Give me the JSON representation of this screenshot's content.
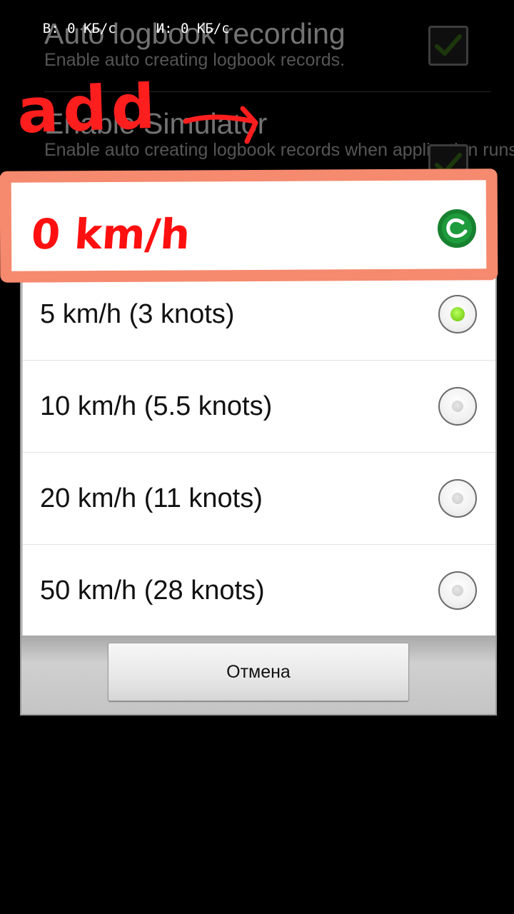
{
  "status_bar": {
    "download": "В: 0 КБ/с",
    "upload": "И: 0 КБ/с"
  },
  "preferences": [
    {
      "title": "Auto logbook recording",
      "summary": "Enable auto creating logbook records.",
      "checked": true
    },
    {
      "title": "Enable Simulator",
      "summary": "Enable auto creating logbook records when application runs in simulator mode",
      "checked": true
    }
  ],
  "dialog": {
    "options": [
      {
        "label": "5 km/h (3 knots)",
        "selected": true
      },
      {
        "label": "10 km/h (5.5 knots)",
        "selected": false
      },
      {
        "label": "20 km/h (11 knots)",
        "selected": false
      },
      {
        "label": "50 km/h (28 knots)",
        "selected": false
      }
    ],
    "cancel_label": "Отмена"
  },
  "annotation": {
    "note": "add",
    "proposed_option": "0 km/h",
    "colors": {
      "ink_red": "#ff1e1e",
      "box_salmon": "#f58a6f",
      "ink_green": "#1e9b3c"
    }
  },
  "colors": {
    "radio_selected": "#7fd321",
    "check_green": "#3f7a1c"
  }
}
